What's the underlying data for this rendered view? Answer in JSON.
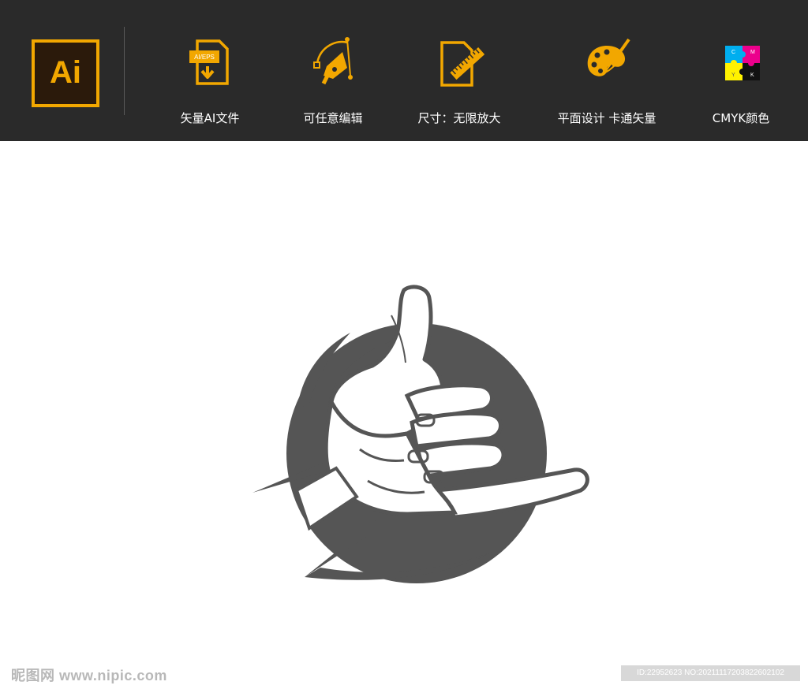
{
  "header": {
    "logo_text": "Ai",
    "features": [
      {
        "label": "矢量AI文件",
        "icon": "document-download-icon",
        "badge": "AI/EPS"
      },
      {
        "label": "可任意编辑",
        "icon": "pen-tool-icon"
      },
      {
        "label": "尺寸：无限放大",
        "icon": "document-ruler-icon"
      },
      {
        "label": "平面设计  卡通矢量",
        "icon": "paint-palette-icon"
      },
      {
        "label": "CMYK颜色",
        "icon": "cmyk-puzzle-icon",
        "cmyk_letters": [
          "C",
          "M",
          "Y",
          "K"
        ]
      }
    ]
  },
  "artwork": {
    "subject": "shaka-hand-icon"
  },
  "watermark": {
    "site": "昵图网 www.nipic.com",
    "id_text": "ID:22952623 NO:20211117203822602102"
  },
  "colors": {
    "topbar_bg": "#2a2a2a",
    "accent": "#f2a700",
    "artwork_gray": "#555555"
  }
}
